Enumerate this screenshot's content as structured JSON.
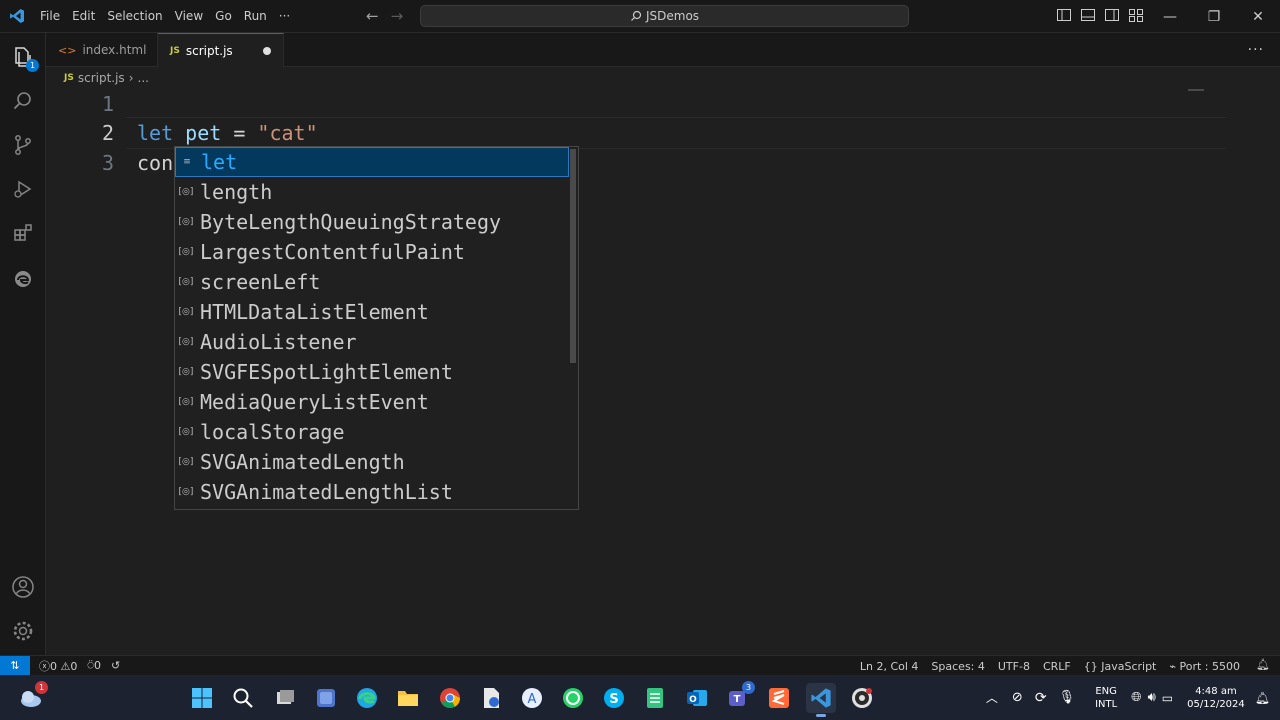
{
  "menu": [
    "File",
    "Edit",
    "Selection",
    "View",
    "Go",
    "Run",
    "···"
  ],
  "search": {
    "label": "JSDemos"
  },
  "tabs": [
    {
      "label": "index.html",
      "icon": "html-file-icon",
      "active": false
    },
    {
      "label": "script.js",
      "icon": "js-file-icon",
      "active": true,
      "modified": true
    }
  ],
  "tabs_more": "···",
  "breadcrumb": {
    "file_icon": "JS",
    "file": "script.js",
    "sep": "›",
    "rest": "..."
  },
  "editor": {
    "lines": [
      {
        "num": "1",
        "tokens": []
      },
      {
        "num": "2",
        "tokens": [
          {
            "t": "let",
            "c": "kw"
          },
          {
            "t": " ",
            "c": "plain"
          },
          {
            "t": "pet",
            "c": "var"
          },
          {
            "t": " = ",
            "c": "op"
          },
          {
            "t": "\"cat\"",
            "c": "str"
          }
        ]
      },
      {
        "num": "3",
        "tokens": [
          {
            "t": "con",
            "c": "plain"
          }
        ]
      }
    ],
    "current_line": "2"
  },
  "suggestions": [
    {
      "label": "let",
      "kind": "keyword",
      "selected": true
    },
    {
      "label": "length",
      "kind": "variable"
    },
    {
      "label": "ByteLengthQueuingStrategy",
      "kind": "variable"
    },
    {
      "label": "LargestContentfulPaint",
      "kind": "variable"
    },
    {
      "label": "screenLeft",
      "kind": "variable"
    },
    {
      "label": "HTMLDataListElement",
      "kind": "variable"
    },
    {
      "label": "AudioListener",
      "kind": "variable"
    },
    {
      "label": "SVGFESpotLightElement",
      "kind": "variable"
    },
    {
      "label": "MediaQueryListEvent",
      "kind": "variable"
    },
    {
      "label": "localStorage",
      "kind": "variable"
    },
    {
      "label": "SVGAnimatedLength",
      "kind": "variable"
    },
    {
      "label": "SVGAnimatedLengthList",
      "kind": "variable"
    }
  ],
  "explorer_badge": "1",
  "status": {
    "errors": "0",
    "warnings": "0",
    "ports": "0",
    "position": "Ln 2, Col 4",
    "spaces": "Spaces: 4",
    "encoding": "UTF-8",
    "eol": "CRLF",
    "language": "JavaScript",
    "port": "Port : 5500"
  },
  "taskbar": {
    "weather_badge": "1",
    "teams_badge": "3",
    "lang_line1": "ENG",
    "lang_line2": "INTL",
    "time": "4:48 am",
    "date": "05/12/2024"
  },
  "colors": {
    "accent": "#0078d4",
    "keyword": "#569cd6",
    "variable": "#9cdcfe",
    "string": "#ce9178",
    "suggest_highlight": "#2aaaff"
  }
}
